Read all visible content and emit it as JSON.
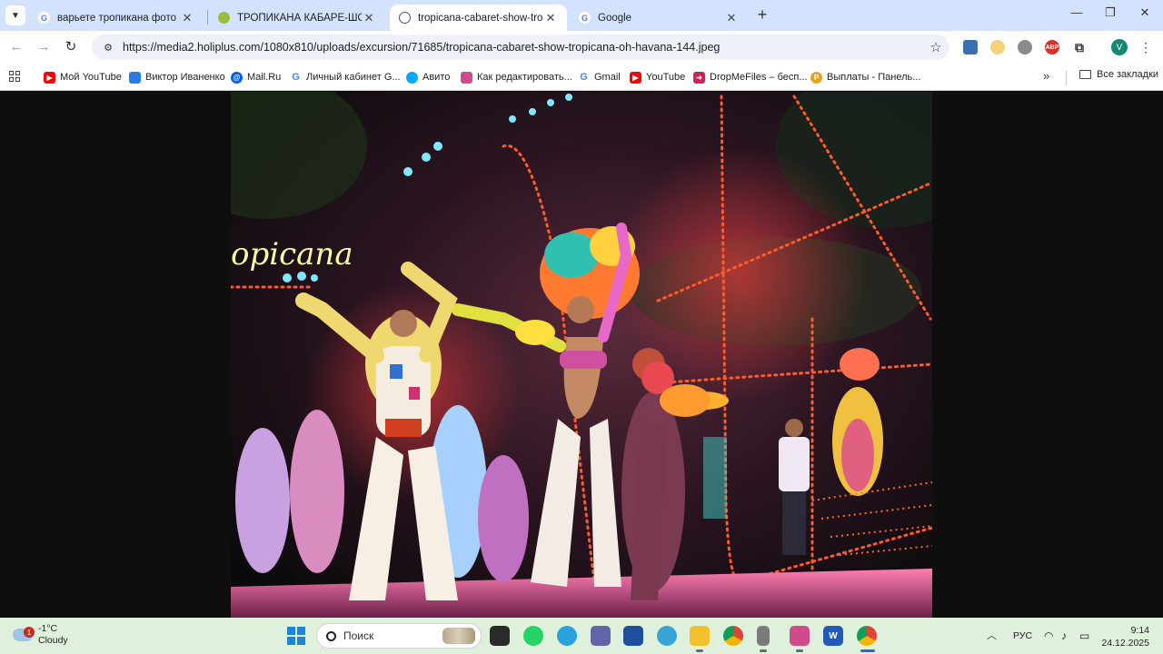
{
  "tabs": [
    {
      "title": "варьете тропикана фото - Пои",
      "favicon": "google-g-icon",
      "active": false
    },
    {
      "title": "ТРОПИКАНА КАБАРЕ-ШОУ \"ТР",
      "favicon": "leaf-icon",
      "active": false
    },
    {
      "title": "tropicana-cabaret-show-tropica",
      "favicon": "globe-icon",
      "active": true
    },
    {
      "title": "Google",
      "favicon": "google-g-icon",
      "active": false
    }
  ],
  "toolbar": {
    "url": "https://media2.holiplus.com/1080x810/uploads/excursion/71685/tropicana-cabaret-show-tropicana-oh-havana-144.jpeg",
    "profile_letter": "V",
    "extension_abp": "ABP"
  },
  "bookmarks": [
    {
      "label": "Мой YouTube",
      "icon": "youtube-icon",
      "color": "#ff0000"
    },
    {
      "label": "Виктор Иваненко",
      "icon": "chat-icon",
      "color": "#2a7ae4"
    },
    {
      "label": "Mail.Ru",
      "icon": "mailru-icon",
      "color": "#005ff9"
    },
    {
      "label": "Личный кабинет G...",
      "icon": "google-g-icon",
      "color": "#4285f4"
    },
    {
      "label": "Авито",
      "icon": "avito-icon",
      "color": "#00aaff"
    },
    {
      "label": "Как редактировать...",
      "icon": "book-icon",
      "color": "#d04a8c"
    },
    {
      "label": "Gmail",
      "icon": "google-g-icon",
      "color": "#4285f4"
    },
    {
      "label": "YouTube",
      "icon": "youtube-icon",
      "color": "#ff0000"
    },
    {
      "label": "DropMeFiles – бесп...",
      "icon": "dropmefiles-icon",
      "color": "#d0205c"
    },
    {
      "label": "Выплаты - Панель...",
      "icon": "payout-icon",
      "color": "#e8a317"
    }
  ],
  "bookmarks_folder": "Все закладки",
  "taskbar": {
    "weather_temp": "-1°C",
    "weather_desc": "Cloudy",
    "weather_badge": "1",
    "search_placeholder": "Поиск",
    "language": "РУС",
    "time": "9:14",
    "date": "24.12.2025"
  },
  "photo": {
    "sign_text": "opicana"
  }
}
